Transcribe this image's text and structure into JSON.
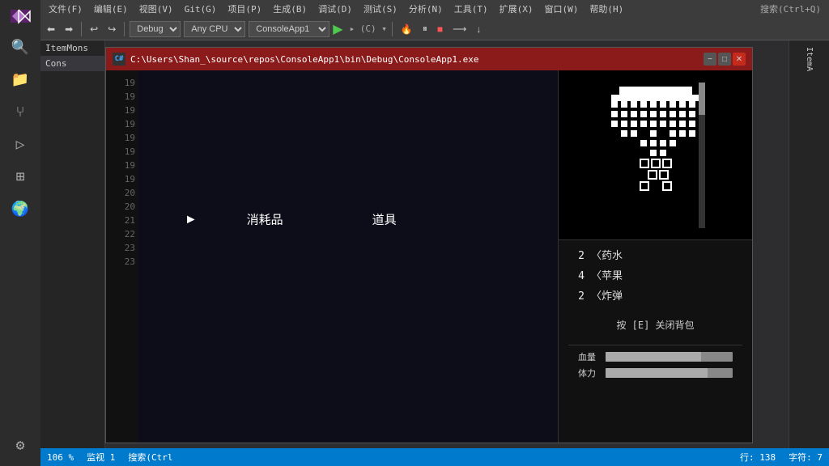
{
  "ide": {
    "title": "Visual Studio",
    "menu": {
      "items": [
        "文件(F)",
        "编辑(E)",
        "视图(V)",
        "Git(G)",
        "项目(P)",
        "生成(B)",
        "调试(D)",
        "测试(S)",
        "分析(N)",
        "工具(T)",
        "扩展(X)",
        "窗口(W)",
        "帮助(H)"
      ]
    },
    "toolbar": {
      "debug_config": "Debug",
      "platform": "Any CPU",
      "project": "ConsoleApp1"
    },
    "console_title": "C:\\Users\\Shan_\\source\\repos\\ConsoleApp1\\bin\\Debug\\ConsoleApp1.exe",
    "solution": {
      "items": [
        "ItemMons",
        "Cons"
      ]
    }
  },
  "status_bar": {
    "line": "行: 138",
    "char": "字符: 7",
    "zoom": "106 %",
    "monitor": "监视 1",
    "search_placeholder": "搜索(Ctrl+Q)"
  },
  "game": {
    "menu": {
      "arrow": "▶",
      "category1": "消耗品",
      "category2": "道具"
    },
    "inventory": {
      "items": [
        {
          "count": "2",
          "name": "〈药水"
        },
        {
          "count": "4",
          "name": "〈苹果"
        },
        {
          "count": "2",
          "name": "〈炸弹"
        }
      ],
      "instruction": "按 [E] 关闭背包"
    },
    "status": {
      "hp_label": "血量",
      "mp_label": "体力",
      "hp_percent": 75,
      "mp_percent": 80
    }
  },
  "line_numbers": [
    "19",
    "19",
    "19",
    "19",
    "19",
    "19",
    "19",
    "19",
    "20",
    "20",
    "21",
    "22",
    "23",
    "23"
  ]
}
